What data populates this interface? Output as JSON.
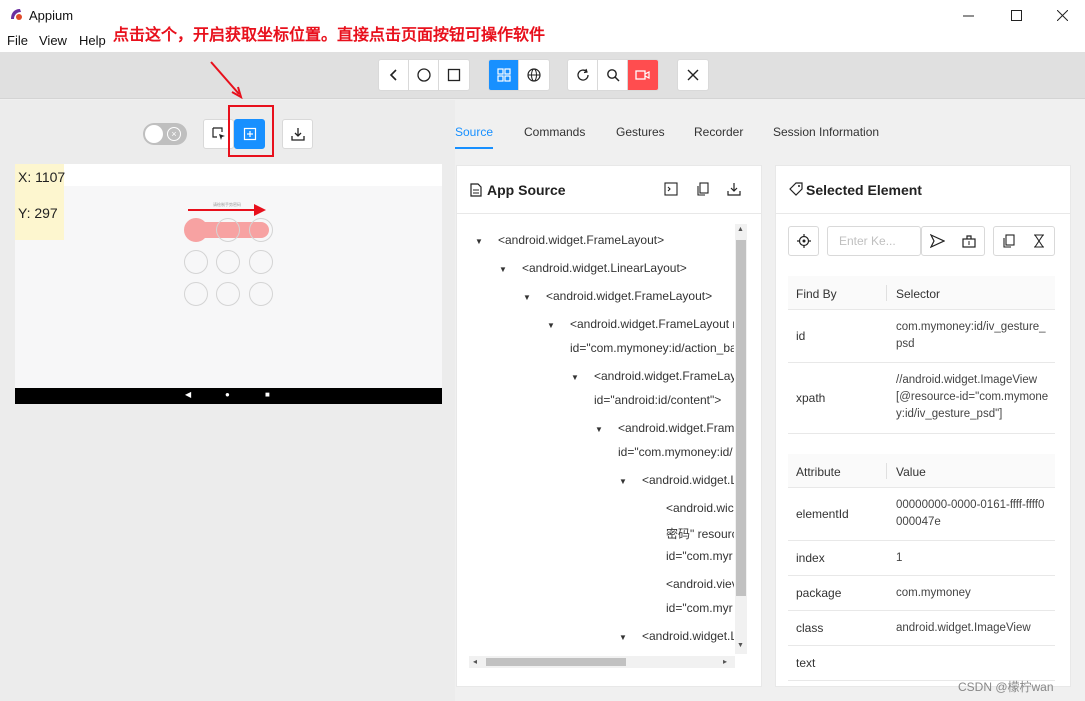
{
  "window": {
    "title": "Appium",
    "minimize_icon": "minimize-icon",
    "maximize_icon": "maximize-icon",
    "close_icon": "close-icon"
  },
  "menu": {
    "items": [
      "File",
      "View",
      "Help"
    ]
  },
  "annotation": {
    "text": "点击这个，开启获取坐标位置。直接点击页面按钮可操作软件"
  },
  "toolbar": {
    "groups": [
      [
        "back-icon",
        "home-icon",
        "app-switch-icon"
      ],
      [
        "native-mode-icon",
        "web-mode-icon"
      ],
      [
        "refresh-icon",
        "search-icon",
        "record-icon"
      ],
      [
        "quit-session-icon"
      ]
    ],
    "accent": "#1890ff",
    "record_color": "#ff4d4f"
  },
  "screenshot_panel": {
    "coordinates": {
      "x": "X: 1107",
      "y": "Y: 297"
    },
    "hint_text": "请绘制手势密码",
    "buttons": [
      "select-elements-icon",
      "tap-coordinates-icon",
      "download-screenshot-icon"
    ]
  },
  "tabs": {
    "items": [
      "Source",
      "Commands",
      "Gestures",
      "Recorder",
      "Session Information"
    ],
    "active": "Source"
  },
  "app_source": {
    "title": "App Source",
    "lines": [
      {
        "text": "<android.widget.FrameLayout>"
      },
      {
        "text": "<android.widget.LinearLayout>"
      },
      {
        "text": "<android.widget.FrameLayout>"
      },
      {
        "text": "<android.widget.FrameLayout r"
      },
      {
        "text": "id=\"com.mymoney:id/action_ba"
      },
      {
        "text": "<android.widget.FrameLay"
      },
      {
        "text": "id=\"android:id/content\">"
      },
      {
        "text": "<android.widget.Fram"
      },
      {
        "text": "id=\"com.mymoney:id/"
      },
      {
        "text": "<android.widget.L"
      },
      {
        "text": "<android.wic"
      },
      {
        "text": "密码\" resourc"
      },
      {
        "text": "id=\"com.myr"
      },
      {
        "text": "<android.viev"
      },
      {
        "text": "id=\"com.myr"
      },
      {
        "text": "<android.widget.L"
      }
    ]
  },
  "selected_element": {
    "title": "Selected Element",
    "search_placeholder": "Enter Ke...",
    "find_by_header": {
      "col1": "Find By",
      "col2": "Selector"
    },
    "selectors": [
      {
        "key": "id",
        "value": "com.mymoney:id/iv_gesture_psd"
      },
      {
        "key": "xpath",
        "value": "//android.widget.ImageView[@resource-id=\"com.mymoney:id/iv_gesture_psd\"]"
      }
    ],
    "attr_header": {
      "col1": "Attribute",
      "col2": "Value"
    },
    "attributes": [
      {
        "key": "elementId",
        "value": "00000000-0000-0161-ffff-ffff0000047e"
      },
      {
        "key": "index",
        "value": "1"
      },
      {
        "key": "package",
        "value": "com.mymoney"
      },
      {
        "key": "class",
        "value": "android.widget.ImageView"
      },
      {
        "key": "text",
        "value": ""
      }
    ]
  },
  "watermark": "CSDN @檬柠wan"
}
